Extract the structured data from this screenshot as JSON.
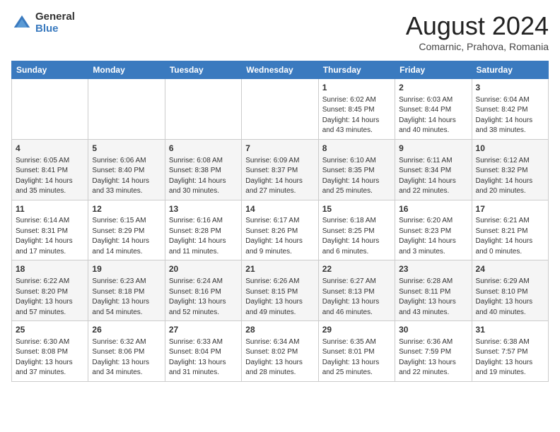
{
  "header": {
    "logo_general": "General",
    "logo_blue": "Blue",
    "month_title": "August 2024",
    "subtitle": "Comarnic, Prahova, Romania"
  },
  "days_of_week": [
    "Sunday",
    "Monday",
    "Tuesday",
    "Wednesday",
    "Thursday",
    "Friday",
    "Saturday"
  ],
  "weeks": [
    [
      {
        "day": "",
        "info": ""
      },
      {
        "day": "",
        "info": ""
      },
      {
        "day": "",
        "info": ""
      },
      {
        "day": "",
        "info": ""
      },
      {
        "day": "1",
        "info": "Sunrise: 6:02 AM\nSunset: 8:45 PM\nDaylight: 14 hours and 43 minutes."
      },
      {
        "day": "2",
        "info": "Sunrise: 6:03 AM\nSunset: 8:44 PM\nDaylight: 14 hours and 40 minutes."
      },
      {
        "day": "3",
        "info": "Sunrise: 6:04 AM\nSunset: 8:42 PM\nDaylight: 14 hours and 38 minutes."
      }
    ],
    [
      {
        "day": "4",
        "info": "Sunrise: 6:05 AM\nSunset: 8:41 PM\nDaylight: 14 hours and 35 minutes."
      },
      {
        "day": "5",
        "info": "Sunrise: 6:06 AM\nSunset: 8:40 PM\nDaylight: 14 hours and 33 minutes."
      },
      {
        "day": "6",
        "info": "Sunrise: 6:08 AM\nSunset: 8:38 PM\nDaylight: 14 hours and 30 minutes."
      },
      {
        "day": "7",
        "info": "Sunrise: 6:09 AM\nSunset: 8:37 PM\nDaylight: 14 hours and 27 minutes."
      },
      {
        "day": "8",
        "info": "Sunrise: 6:10 AM\nSunset: 8:35 PM\nDaylight: 14 hours and 25 minutes."
      },
      {
        "day": "9",
        "info": "Sunrise: 6:11 AM\nSunset: 8:34 PM\nDaylight: 14 hours and 22 minutes."
      },
      {
        "day": "10",
        "info": "Sunrise: 6:12 AM\nSunset: 8:32 PM\nDaylight: 14 hours and 20 minutes."
      }
    ],
    [
      {
        "day": "11",
        "info": "Sunrise: 6:14 AM\nSunset: 8:31 PM\nDaylight: 14 hours and 17 minutes."
      },
      {
        "day": "12",
        "info": "Sunrise: 6:15 AM\nSunset: 8:29 PM\nDaylight: 14 hours and 14 minutes."
      },
      {
        "day": "13",
        "info": "Sunrise: 6:16 AM\nSunset: 8:28 PM\nDaylight: 14 hours and 11 minutes."
      },
      {
        "day": "14",
        "info": "Sunrise: 6:17 AM\nSunset: 8:26 PM\nDaylight: 14 hours and 9 minutes."
      },
      {
        "day": "15",
        "info": "Sunrise: 6:18 AM\nSunset: 8:25 PM\nDaylight: 14 hours and 6 minutes."
      },
      {
        "day": "16",
        "info": "Sunrise: 6:20 AM\nSunset: 8:23 PM\nDaylight: 14 hours and 3 minutes."
      },
      {
        "day": "17",
        "info": "Sunrise: 6:21 AM\nSunset: 8:21 PM\nDaylight: 14 hours and 0 minutes."
      }
    ],
    [
      {
        "day": "18",
        "info": "Sunrise: 6:22 AM\nSunset: 8:20 PM\nDaylight: 13 hours and 57 minutes."
      },
      {
        "day": "19",
        "info": "Sunrise: 6:23 AM\nSunset: 8:18 PM\nDaylight: 13 hours and 54 minutes."
      },
      {
        "day": "20",
        "info": "Sunrise: 6:24 AM\nSunset: 8:16 PM\nDaylight: 13 hours and 52 minutes."
      },
      {
        "day": "21",
        "info": "Sunrise: 6:26 AM\nSunset: 8:15 PM\nDaylight: 13 hours and 49 minutes."
      },
      {
        "day": "22",
        "info": "Sunrise: 6:27 AM\nSunset: 8:13 PM\nDaylight: 13 hours and 46 minutes."
      },
      {
        "day": "23",
        "info": "Sunrise: 6:28 AM\nSunset: 8:11 PM\nDaylight: 13 hours and 43 minutes."
      },
      {
        "day": "24",
        "info": "Sunrise: 6:29 AM\nSunset: 8:10 PM\nDaylight: 13 hours and 40 minutes."
      }
    ],
    [
      {
        "day": "25",
        "info": "Sunrise: 6:30 AM\nSunset: 8:08 PM\nDaylight: 13 hours and 37 minutes."
      },
      {
        "day": "26",
        "info": "Sunrise: 6:32 AM\nSunset: 8:06 PM\nDaylight: 13 hours and 34 minutes."
      },
      {
        "day": "27",
        "info": "Sunrise: 6:33 AM\nSunset: 8:04 PM\nDaylight: 13 hours and 31 minutes."
      },
      {
        "day": "28",
        "info": "Sunrise: 6:34 AM\nSunset: 8:02 PM\nDaylight: 13 hours and 28 minutes."
      },
      {
        "day": "29",
        "info": "Sunrise: 6:35 AM\nSunset: 8:01 PM\nDaylight: 13 hours and 25 minutes."
      },
      {
        "day": "30",
        "info": "Sunrise: 6:36 AM\nSunset: 7:59 PM\nDaylight: 13 hours and 22 minutes."
      },
      {
        "day": "31",
        "info": "Sunrise: 6:38 AM\nSunset: 7:57 PM\nDaylight: 13 hours and 19 minutes."
      }
    ]
  ]
}
